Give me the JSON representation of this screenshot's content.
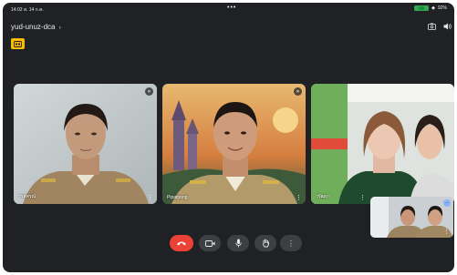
{
  "status_bar": {
    "time": "14:02  ส. 14 ก.ค.",
    "dots": "•••",
    "battery_percent": "92%"
  },
  "meeting": {
    "code": "yud-unuz-dca",
    "code_chevron": "›"
  },
  "icons": {
    "captions_badge": "info-badge-icon",
    "camera_switch": "camera-switch-icon",
    "speaker": "speaker-icon"
  },
  "participants": [
    {
      "name": "วรสุพรณ์",
      "mic": "muted"
    },
    {
      "name": "Pipatpong",
      "mic": "muted"
    },
    {
      "name": "วรัฒฤา",
      "mic": "on"
    }
  ],
  "controls": [
    "end-call",
    "camera",
    "microphone",
    "raise-hand",
    "more-options"
  ],
  "colors": {
    "background": "#202124",
    "end_call": "#ea4335",
    "control": "#3c4043",
    "badge": "#fbbc04",
    "battery": "#34a853"
  }
}
